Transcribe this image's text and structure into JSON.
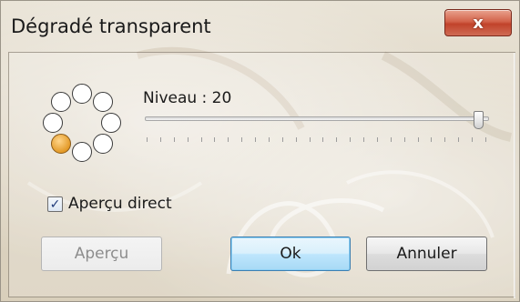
{
  "window": {
    "title": "Dégradé transparent",
    "close_label": "x"
  },
  "spinner": {
    "dot_count": 8,
    "active_dot_color": "#e39a28"
  },
  "level": {
    "label": "Niveau : 20",
    "value": 20,
    "fraction": 0.985
  },
  "live_preview": {
    "checked": true,
    "label": "Aperçu direct"
  },
  "buttons": {
    "preview_label": "Aperçu",
    "ok_label": "Ok",
    "cancel_label": "Annuler"
  },
  "colors": {
    "close_button": "#c1432b",
    "default_button_border": "#3c7fb1"
  }
}
